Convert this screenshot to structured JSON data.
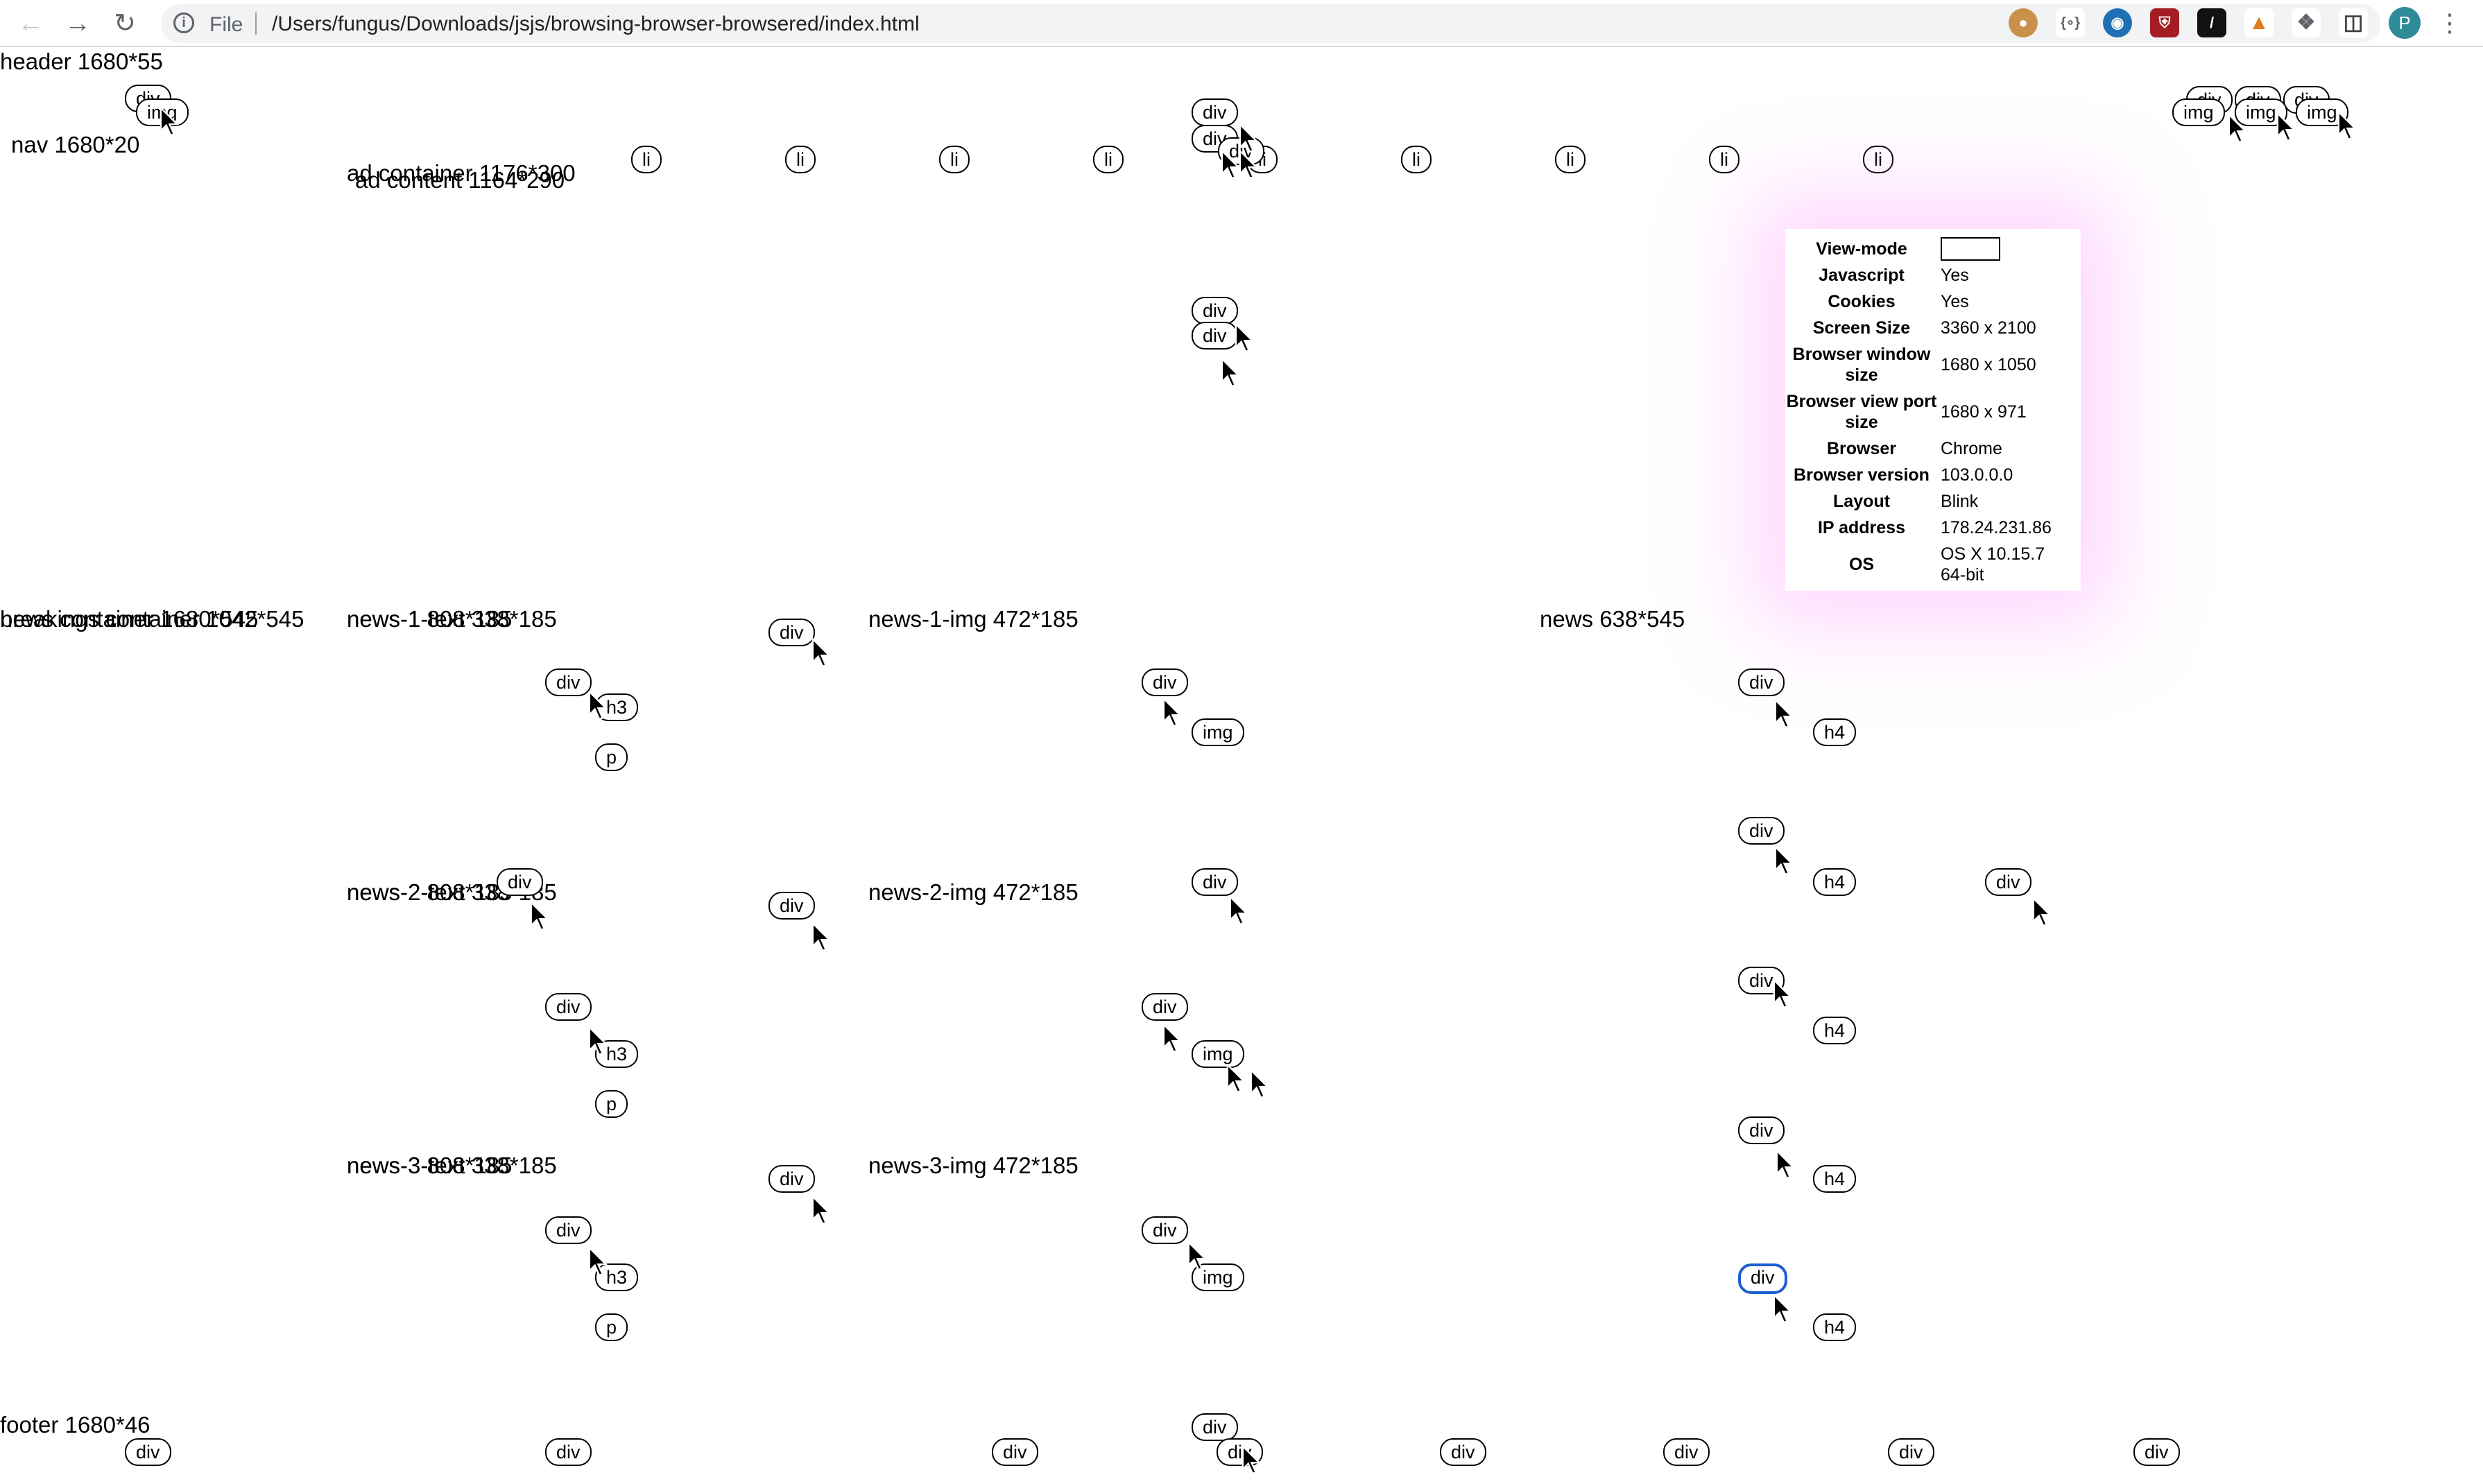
{
  "browser": {
    "scheme_label": "File",
    "url": "/Users/fungus/Downloads/jsjs/browsing-browser-browsered/index.html",
    "back_icon": "arrow-left-icon",
    "forward_icon": "arrow-right-icon",
    "reload_icon": "reload-icon",
    "profile_initial": "P"
  },
  "sections": {
    "header": "header 1680*55",
    "nav": "nav 1680*20",
    "ad_container": "ad container 1176*300",
    "ad_content": "ad content 1164*290",
    "overlap_a": "breakings container 1042*545",
    "overlap_b": "news container 1680*545",
    "news1_text": "news-1-text 338*185",
    "news1_box": "news-1 808*185",
    "news1_img": "news-1-img 472*185",
    "news2_text": "news-2-text 338*185",
    "news2_box": "news-2 808*185",
    "news2_img": "news-2-img 472*185",
    "news3_text": "news-3-text 338*185",
    "news3_box": "news-3 808*185",
    "news3_img": "news-3-img 472*185",
    "news": "news 638*545",
    "footer": "footer 1680*46"
  },
  "tags": {
    "div": "div",
    "img": "img",
    "li": "li",
    "h3": "h3",
    "h4": "h4",
    "p": "p"
  },
  "info_panel": {
    "rows": [
      {
        "key": "View-mode",
        "value": ""
      },
      {
        "key": "Javascript",
        "value": "Yes"
      },
      {
        "key": "Cookies",
        "value": "Yes"
      },
      {
        "key": "Screen Size",
        "value": "3360 x 2100"
      },
      {
        "key": "Browser window size",
        "value": "1680 x 1050"
      },
      {
        "key": "Browser view port size",
        "value": "1680 x 971"
      },
      {
        "key": "Browser",
        "value": "Chrome"
      },
      {
        "key": "Browser version",
        "value": "103.0.0.0"
      },
      {
        "key": "Layout",
        "value": "Blink"
      },
      {
        "key": "IP address",
        "value": "178.24.231.86"
      },
      {
        "key": "OS",
        "value": "OS X 10.15.7 64-bit"
      }
    ]
  }
}
